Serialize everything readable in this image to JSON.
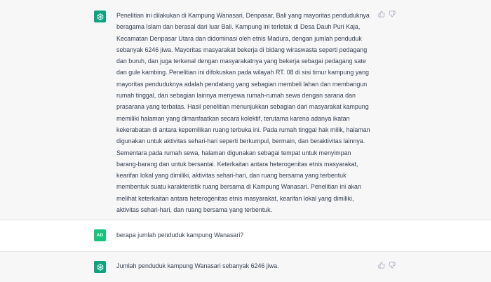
{
  "conversation": {
    "assistant_message_1": "Penelitian ini dilakukan di Kampung Wanasari, Denpasar, Bali yang mayoritas penduduknya beragama Islam dan berasal dari luar Bali. Kampung ini terletak di Desa Dauh Puri Kaja, Kecamatan Denpasar Utara dan didominasi oleh etnis Madura, dengan jumlah penduduk sebanyak 6246 jiwa. Mayoritas masyarakat bekerja di bidang wiraswasta seperti pedagang dan buruh, dan juga terkenal dengan masyarakatnya yang bekerja sebagai pedagang sate dan gule kambing. Penelitian ini difokuskan pada wilayah RT. 08 di sisi timur kampung yang mayoritas penduduknya adalah pendatang yang sebagian membeli lahan dan membangun rumah tinggal, dan sebagian lainnya menyewa rumah-rumah sewa dengan sarana dan prasarana yang terbatas. Hasil penelitian menunjukkan sebagian dari masyarakat kampung memiliki halaman yang dimanfaatkan secara kolektif, terutama karena adanya ikatan kekerabatan di antara kepemilikan ruang terbuka ini. Pada rumah tinggal hak milik, halaman digunakan untuk aktivitas sehari-hari seperti berkumpul, bermain, dan beraktivitas lainnya. Sementara pada rumah sewa, halaman digunakan sebagai tempat untuk menyimpan barang-barang dan untuk bersantai. Keterkaitan antara heterogenitas etnis masyarakat, kearifan lokal yang dimiliki, aktivitas sehari-hari, dan ruang bersama yang terbentuk membentuk suatu karakteristik ruang bersama di Kampung Wanasari. Penelitian ini akan melihat keterkaitan antara heterogenitas etnis masyarakat, kearifan lokal yang dimiliki, aktivitas sehari-hari, dan ruang bersama yang terbentuk.",
    "user_avatar_initials": "AD",
    "user_message": "berapa jumlah penduduk kampung Wanasari?",
    "assistant_message_2": "Jumlah penduduk kampung Wanasari sebanyak 6246 jiwa."
  },
  "colors": {
    "assistant_bg": "#f7f7f8",
    "user_bg": "#ffffff",
    "bot_avatar": "#10a37f",
    "user_avatar": "#19c37d",
    "text": "#374151",
    "icon": "#acacbe"
  },
  "icons": {
    "bot_avatar": "openai-logo-icon",
    "thumbs_up": "thumbs-up-icon",
    "thumbs_down": "thumbs-down-icon"
  }
}
